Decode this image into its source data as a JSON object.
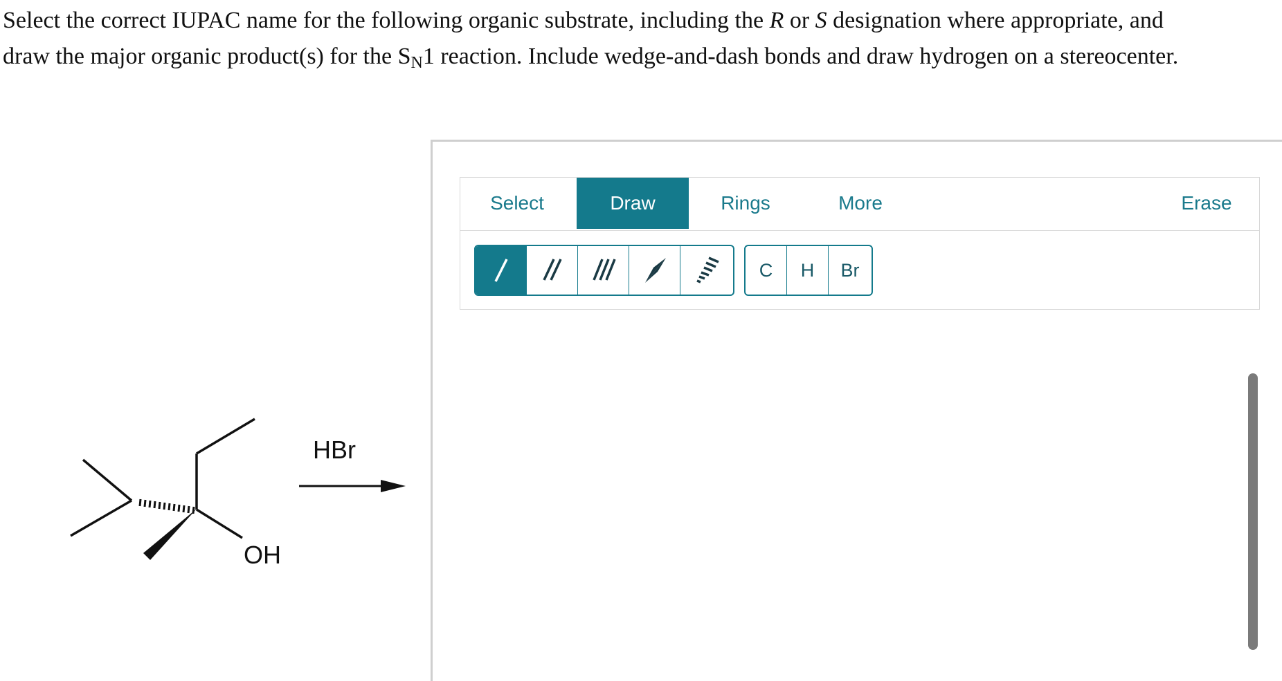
{
  "question": {
    "line1_a": "Select the correct IUPAC name for the following organic substrate, including the ",
    "line1_r": "R",
    "line1_or": " or ",
    "line1_s": "S",
    "line1_b": " designation where appropriate, and",
    "line2_a": "draw the major organic product(s) for the S",
    "line2_sub": "N",
    "line2_b": "1 reaction. Include wedge-and-dash bonds and draw hydrogen on a stereocenter."
  },
  "reaction": {
    "reagent": "HBr",
    "substituent": "OH"
  },
  "toolbar": {
    "tabs": [
      {
        "label": "Select",
        "active": false
      },
      {
        "label": "Draw",
        "active": true
      },
      {
        "label": "Rings",
        "active": false
      },
      {
        "label": "More",
        "active": false
      },
      {
        "label": "Erase",
        "active": false
      }
    ],
    "bond_tools": [
      "single-bond-icon",
      "double-bond-icon",
      "triple-bond-icon",
      "wedge-bond-icon",
      "dash-bond-icon"
    ],
    "atoms": [
      "C",
      "H",
      "Br"
    ]
  },
  "colors": {
    "accent": "#147a8c",
    "text": "#111111",
    "border": "#d8d8d8",
    "scrollbar": "#7a7a7a"
  }
}
